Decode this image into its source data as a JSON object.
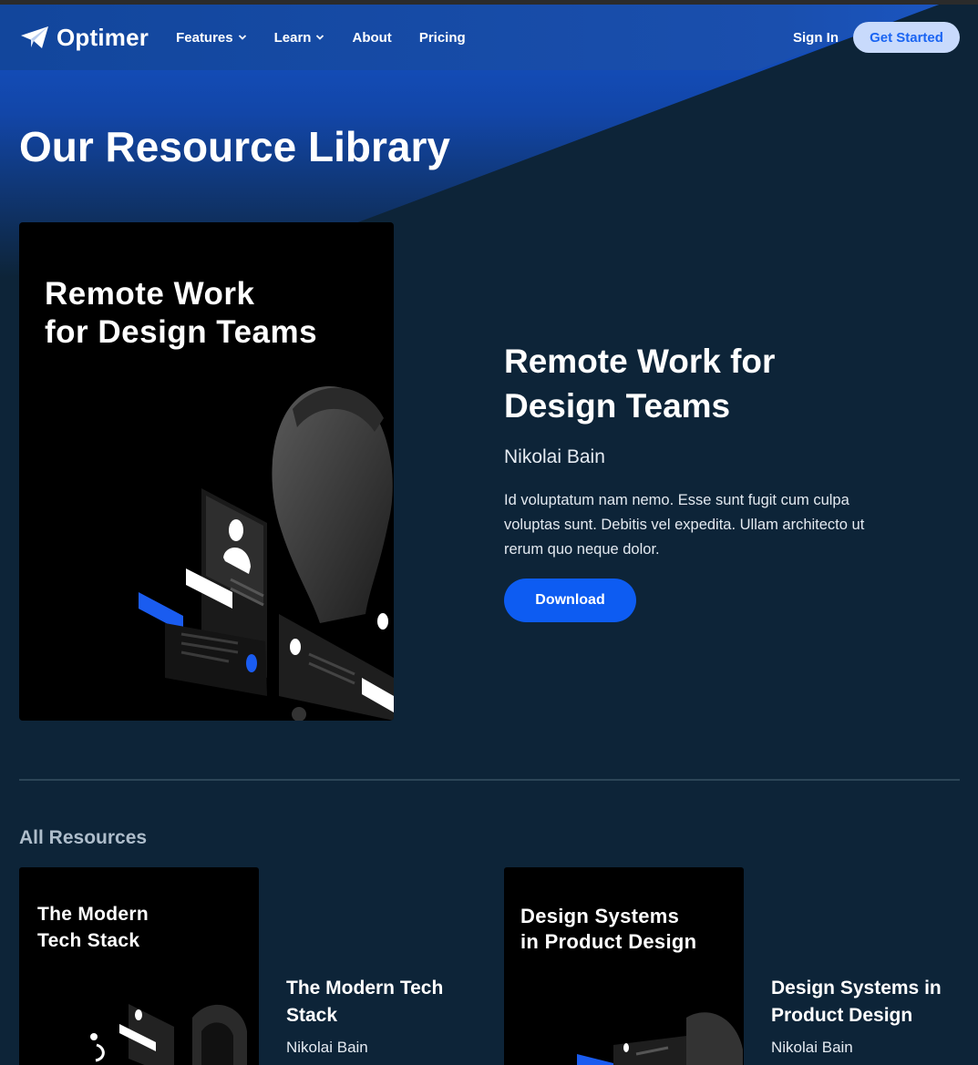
{
  "nav": {
    "brand": "Optimer",
    "items": [
      {
        "label": "Features",
        "dropdown": true
      },
      {
        "label": "Learn",
        "dropdown": true
      },
      {
        "label": "About",
        "dropdown": false
      },
      {
        "label": "Pricing",
        "dropdown": false
      }
    ],
    "sign_in": "Sign In",
    "get_started": "Get Started"
  },
  "page": {
    "title": "Our Resource Library"
  },
  "featured": {
    "cover_title": "Remote Work\nfor Design Teams",
    "title": "Remote Work for\nDesign Teams",
    "author": "Nikolai Bain",
    "description": "Id voluptatum nam nemo. Esse sunt fugit cum culpa voluptas sunt. Debitis vel expedita. Ullam architecto ut rerum quo neque dolor.",
    "download_label": "Download"
  },
  "all_resources": {
    "heading": "All Resources",
    "cards": [
      {
        "cover_title": "The Modern\nTech Stack",
        "title": "The Modern Tech\nStack",
        "author": "Nikolai Bain"
      },
      {
        "cover_title": "Design Systems\nin Product Design",
        "title": "Design Systems in\nProduct Design",
        "author": "Nikolai Bain"
      }
    ]
  },
  "colors": {
    "background": "#0d2438",
    "hero_blue": "#1553c9",
    "primary_button": "#0d5cf2",
    "cta_light": "#c8dafc",
    "accent_blue": "#1a5cf0"
  },
  "icons": {
    "logo": "paper-plane-icon",
    "dropdown": "chevron-down-icon"
  }
}
